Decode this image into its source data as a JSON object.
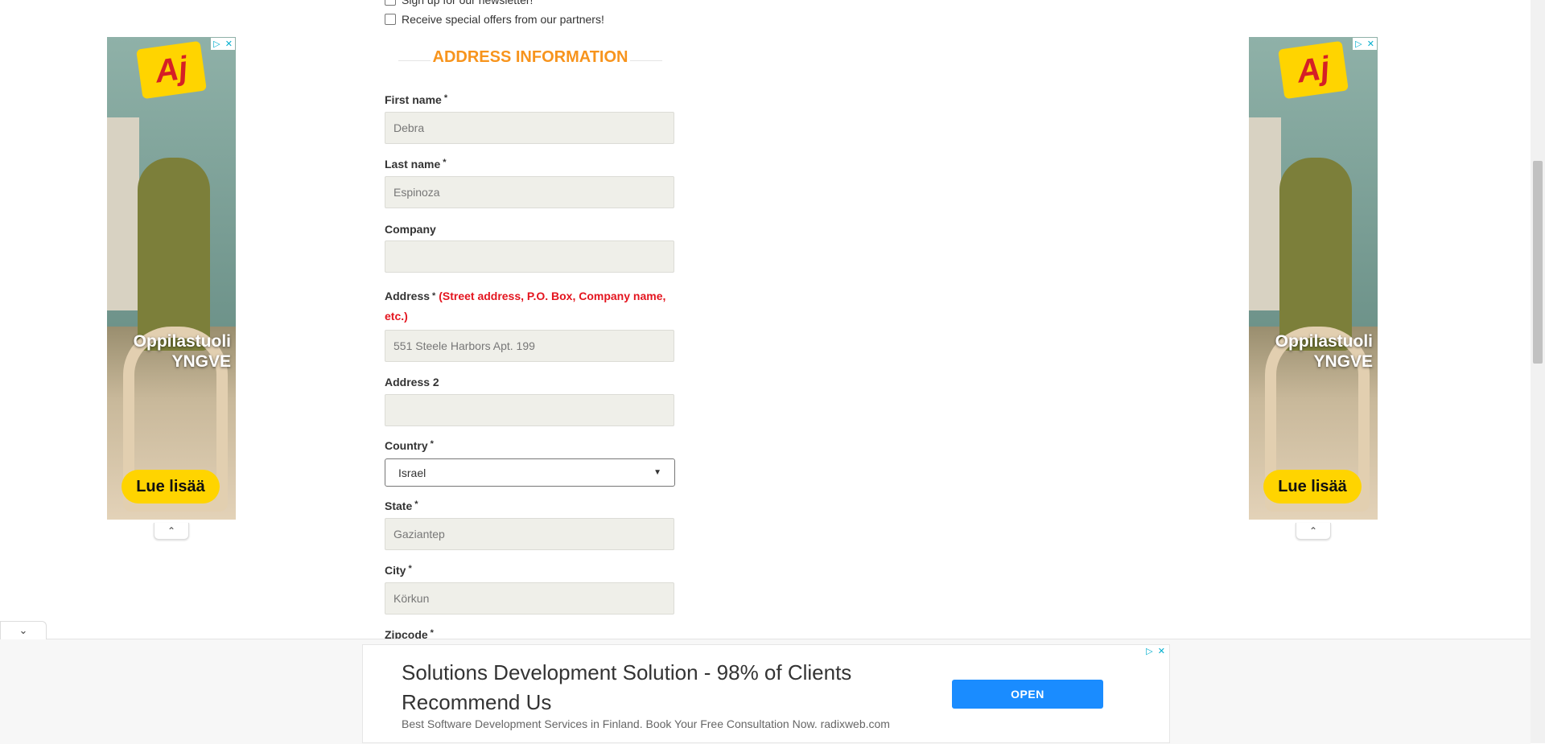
{
  "checkboxes": [
    {
      "label": "Sign up for our newsletter!",
      "checked": false
    },
    {
      "label": "Receive special offers from our partners!",
      "checked": false
    }
  ],
  "section": {
    "title": "ADDRESS INFORMATION"
  },
  "fields": {
    "first_name": {
      "label": "First name",
      "required": "*",
      "value": "Debra"
    },
    "last_name": {
      "label": "Last name",
      "required": "*",
      "value": "Espinoza"
    },
    "company": {
      "label": "Company",
      "value": ""
    },
    "address": {
      "label": "Address",
      "required": "*",
      "hint": "(Street address, P.O. Box, Company name, etc.)",
      "value": "551 Steele Harbors Apt. 199"
    },
    "address2": {
      "label": "Address 2",
      "value": ""
    },
    "country": {
      "label": "Country",
      "required": "*",
      "value": "Israel"
    },
    "state": {
      "label": "State",
      "required": "*",
      "value": "Gaziantep"
    },
    "city": {
      "label": "City",
      "required": "*",
      "value": "Körkun"
    },
    "zipcode": {
      "label": "Zipcode",
      "required": "*"
    }
  },
  "side_ad": {
    "logo": "Aj",
    "headline_line1": "Oppilastuoli",
    "headline_line2": "YNGVE",
    "cta": "Lue lisää",
    "adchoices_icon": "adchoices-icon",
    "close_icon": "close-icon",
    "collapse_icon": "chevron-up-icon"
  },
  "bottom_ad": {
    "title": "Solutions Development Solution - 98% of Clients Recommend Us",
    "description": "Best Software Development Services in Finland. Book Your Free Consultation Now. radixweb.com",
    "cta": "OPEN",
    "toggle_icon": "chevron-down-icon"
  },
  "colors": {
    "accent": "#f7941d",
    "hint_red": "#e4151f",
    "input_bg": "#efefe9",
    "open_button": "#1a8cff",
    "ad_yellow": "#ffd400"
  }
}
